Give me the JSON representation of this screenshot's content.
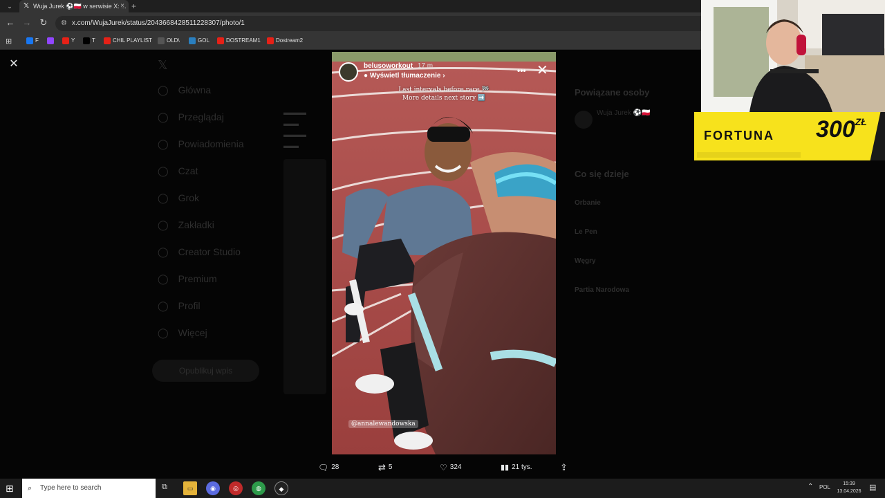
{
  "browser": {
    "tab_title": "Wuja Jurek ⚽🇵🇱 w serwisie X: ...",
    "tab_close": "×",
    "new_tab": "+",
    "url": "x.com/WujaJurek/status/2043668428511228307/photo/1",
    "bookmarks": [
      {
        "label": "F",
        "color": "#1877f2"
      },
      {
        "label": "",
        "color": "#9146ff"
      },
      {
        "label": "Y",
        "color": "#e62117"
      },
      {
        "label": "T",
        "color": "#000000"
      },
      {
        "label": "CHIL PLAYLIST",
        "color": "#e62117"
      },
      {
        "label": "OLD\\",
        "color": "#555555"
      },
      {
        "label": "GOL",
        "color": "#2a7fbf"
      },
      {
        "label": "DOSTREAM1",
        "color": "#e62117"
      },
      {
        "label": "Dostream2",
        "color": "#e62117"
      }
    ]
  },
  "sidebar_nav": [
    "Główna",
    "Przeglądaj",
    "Powiadomienia",
    "Czat",
    "Grok",
    "Zakładki",
    "Creator Studio",
    "Premium",
    "Profil",
    "Więcej"
  ],
  "sidebar_post_button": "Opublikuj wpis",
  "right_panel": {
    "related_heading": "Powiązane osoby",
    "related_user": "Wuja Jurek ⚽🇵🇱",
    "trends_heading": "Co się dzieje",
    "trends": [
      "Orbanie",
      "Le Pen",
      "Węgry",
      "Partia Narodowa"
    ]
  },
  "story": {
    "username": "belusoworkout",
    "time": "17 m",
    "translate": "Wyświetl tłumaczenie",
    "line1": "Last intervals before race 🏁",
    "line2": "More details next story ➡️",
    "mention": "@annalewandowska"
  },
  "actions": {
    "replies": "28",
    "reposts": "5",
    "likes": "324",
    "views": "21 tys."
  },
  "overlay": {
    "brand": "FORTUNA",
    "bonus": "300",
    "currency": "ZŁ"
  },
  "taskbar": {
    "search_placeholder": "Type here to search",
    "language": "POL",
    "time": "15:39",
    "date": "13.04.2026"
  }
}
